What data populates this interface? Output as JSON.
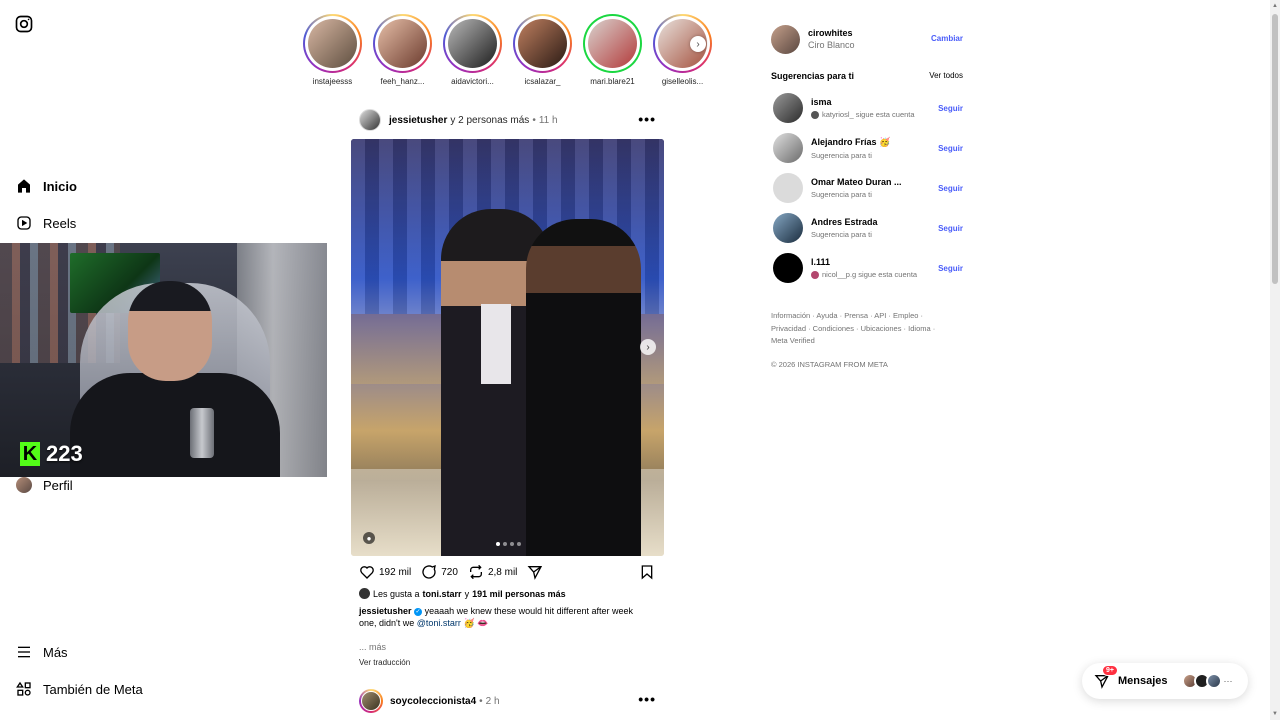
{
  "sidebar": {
    "logo_icon": "instagram-icon",
    "items": [
      {
        "label": "Inicio",
        "icon": "home-icon"
      },
      {
        "label": "Reels",
        "icon": "reels-icon"
      },
      {
        "label": "Perfil",
        "icon": "avatar"
      },
      {
        "label": "Más",
        "icon": "menu-icon"
      },
      {
        "label": "También de Meta",
        "icon": "meta-apps-icon"
      }
    ]
  },
  "webcam": {
    "viewer_count": "223",
    "badge_letter": "K",
    "badge_color": "#53fc18"
  },
  "stories": [
    {
      "name": "instajeesss",
      "ring": "gradient"
    },
    {
      "name": "feeh_hanz...",
      "ring": "gradient"
    },
    {
      "name": "aidavictori...",
      "ring": "gradient"
    },
    {
      "name": "icsalazar_",
      "ring": "gradient"
    },
    {
      "name": "mari.blare21",
      "ring": "close-friends"
    },
    {
      "name": "giselleolis...",
      "ring": "gradient"
    }
  ],
  "post": {
    "username": "jessietusher",
    "and_others": "y 2 personas más",
    "dot": "•",
    "time": "11 h",
    "more_icon": "•••",
    "likes_count": "192 mil",
    "comments_count": "720",
    "reposts_count": "2,8 mil",
    "liked_by_prefix": "Les gusta a",
    "liked_by_user": "toni.starr",
    "liked_by_join": "y",
    "liked_by_others": "191 mil personas más",
    "caption_user": "jessietusher",
    "caption_text": "yeaaah we knew these would hit different after week one, didn't we",
    "caption_mention": "@toni.starr",
    "caption_emojis": "🥳 👄",
    "more_label": "... más",
    "translate_label": "Ver traducción",
    "carousel_dots": 4,
    "carousel_active": 0
  },
  "post2": {
    "username": "soycoleccionista4",
    "dot": "•",
    "time": "2 h",
    "more_icon": "•••"
  },
  "me": {
    "username": "cirowhites",
    "name": "Ciro Blanco",
    "switch_label": "Cambiar"
  },
  "suggestions": {
    "title": "Sugerencias para ti",
    "see_all": "Ver todos",
    "follow_label": "Seguir",
    "items": [
      {
        "username": "isma",
        "sub": "katyriosl_ sigue esta cuenta",
        "has_mini": true,
        "avatar_color": "#4a4a4a"
      },
      {
        "username": "Alejandro Frías 🥳",
        "sub": "Sugerencia para ti",
        "has_mini": false,
        "avatar_color": "#9c9c9c"
      },
      {
        "username": "Omar Mateo Duran ...",
        "sub": "Sugerencia para ti",
        "has_mini": false,
        "avatar_color": "#dbdbdb"
      },
      {
        "username": "Andres Estrada",
        "sub": "Sugerencia para ti",
        "has_mini": false,
        "avatar_color": "#2f4e6a"
      },
      {
        "username": "l.111",
        "sub": "nicol__p.g sigue esta cuenta",
        "has_mini": true,
        "avatar_color": "#000000"
      }
    ]
  },
  "footer": {
    "links": "Información · Ayuda · Prensa · API · Empleo · Privacidad · Condiciones · Ubicaciones · Idioma · Meta Verified",
    "copyright": "© 2026 INSTAGRAM FROM META"
  },
  "messages": {
    "label": "Mensajes",
    "badge": "9+",
    "more": "···"
  },
  "colors": {
    "link_blue": "#4a5df9",
    "badge_red": "#ff3040",
    "mention": "#00376b"
  }
}
